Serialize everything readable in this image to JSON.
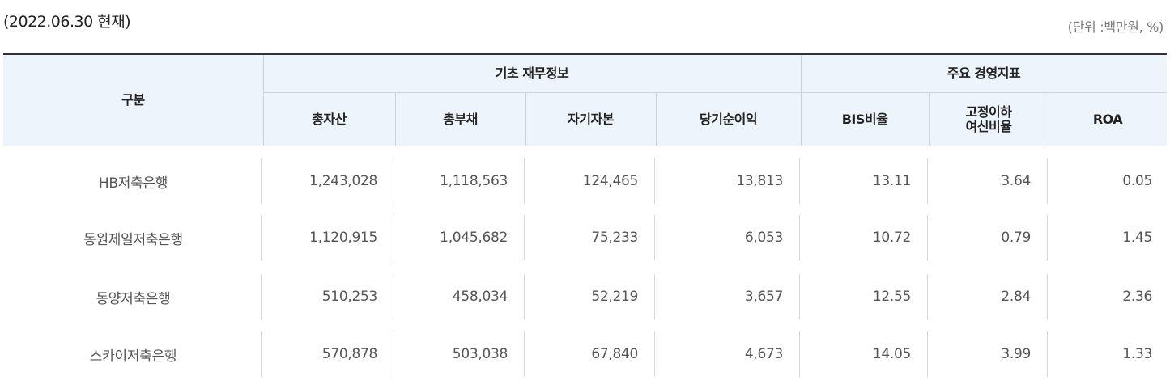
{
  "date_note": "(2022.06.30 현재)",
  "unit_note": "(단위 :백만원, %)",
  "headers": {
    "category": "구분",
    "group_basic": "기초 재무정보",
    "group_key": "주요 경영지표",
    "total_assets": "총자산",
    "total_liabilities": "총부채",
    "equity": "자기자본",
    "net_income": "당기순이익",
    "bis": "BIS비율",
    "npl_line1": "고정이하",
    "npl_line2": "여신비율",
    "roa": "ROA"
  },
  "rows": [
    {
      "name": "HB저축은행",
      "total_assets": "1,243,028",
      "total_liabilities": "1,118,563",
      "equity": "124,465",
      "net_income": "13,813",
      "bis": "13.11",
      "npl": "3.64",
      "roa": "0.05"
    },
    {
      "name": "동원제일저축은행",
      "total_assets": "1,120,915",
      "total_liabilities": "1,045,682",
      "equity": "75,233",
      "net_income": "6,053",
      "bis": "10.72",
      "npl": "0.79",
      "roa": "1.45"
    },
    {
      "name": "동양저축은행",
      "total_assets": "510,253",
      "total_liabilities": "458,034",
      "equity": "52,219",
      "net_income": "3,657",
      "bis": "12.55",
      "npl": "2.84",
      "roa": "2.36"
    },
    {
      "name": "스카이저축은행",
      "total_assets": "570,878",
      "total_liabilities": "503,038",
      "equity": "67,840",
      "net_income": "4,673",
      "bis": "14.05",
      "npl": "3.99",
      "roa": "1.33"
    }
  ]
}
